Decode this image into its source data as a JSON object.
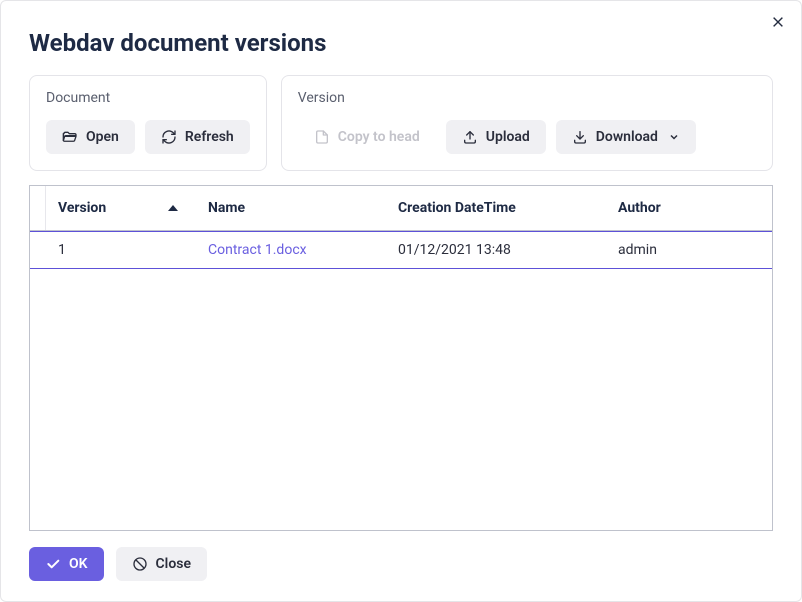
{
  "dialog": {
    "title": "Webdav document versions"
  },
  "panels": {
    "document": {
      "title": "Document",
      "open": "Open",
      "refresh": "Refresh"
    },
    "version": {
      "title": "Version",
      "copy_to_head": "Copy to head",
      "upload": "Upload",
      "download": "Download"
    }
  },
  "table": {
    "columns": {
      "version": "Version",
      "name": "Name",
      "created": "Creation DateTime",
      "author": "Author"
    },
    "rows": [
      {
        "version": "1",
        "name": "Contract 1.docx",
        "created": "01/12/2021 13:48",
        "author": "admin"
      }
    ]
  },
  "footer": {
    "ok": "OK",
    "close": "Close"
  }
}
